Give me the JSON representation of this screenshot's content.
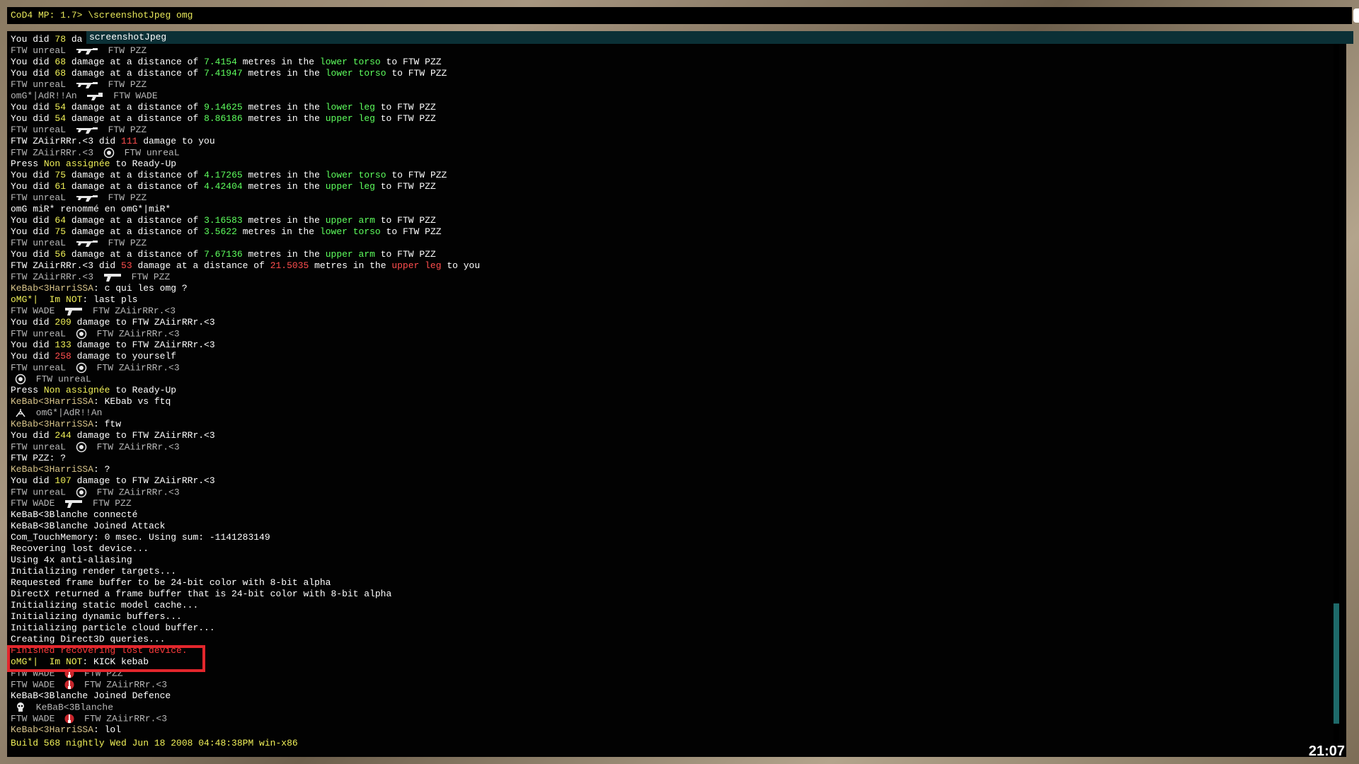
{
  "console": {
    "prompt": "CoD4 MP: 1.7>",
    "command": "\\screenshotJpeg omg",
    "autocomplete": "screenshotJpeg",
    "lines": [
      {
        "s": "normal",
        "p": [
          {
            "t": "You did "
          },
          {
            "t": "78",
            "c": "y"
          },
          {
            "t": " da"
          }
        ]
      },
      {
        "s": "dim",
        "p": [
          {
            "t": "FTW unreaL "
          },
          {
            "icon": "rifle-icon"
          },
          {
            "t": " FTW PZZ"
          }
        ]
      },
      {
        "s": "normal",
        "p": [
          {
            "t": "You did "
          },
          {
            "t": "68",
            "c": "y"
          },
          {
            "t": " damage at a distance of "
          },
          {
            "t": "7.4154",
            "c": "g"
          },
          {
            "t": " metres in the "
          },
          {
            "t": "lower torso",
            "c": "g"
          },
          {
            "t": " to FTW PZZ"
          }
        ]
      },
      {
        "s": "normal",
        "p": [
          {
            "t": "You did "
          },
          {
            "t": "68",
            "c": "y"
          },
          {
            "t": " damage at a distance of "
          },
          {
            "t": "7.41947",
            "c": "g"
          },
          {
            "t": " metres in the "
          },
          {
            "t": "lower torso",
            "c": "g"
          },
          {
            "t": " to FTW PZZ"
          }
        ]
      },
      {
        "s": "dim",
        "p": [
          {
            "t": "FTW unreaL "
          },
          {
            "icon": "rifle-icon"
          },
          {
            "t": " FTW PZZ"
          }
        ]
      },
      {
        "s": "dim",
        "p": [
          {
            "t": "omG*|AdR!!An "
          },
          {
            "icon": "grenade-launcher-icon"
          },
          {
            "t": " FTW WADE"
          }
        ]
      },
      {
        "s": "normal",
        "p": [
          {
            "t": "You did "
          },
          {
            "t": "54",
            "c": "y"
          },
          {
            "t": " damage at a distance of "
          },
          {
            "t": "9.14625",
            "c": "g"
          },
          {
            "t": " metres in the "
          },
          {
            "t": "lower leg",
            "c": "g"
          },
          {
            "t": " to FTW PZZ"
          }
        ]
      },
      {
        "s": "normal",
        "p": [
          {
            "t": "You did "
          },
          {
            "t": "54",
            "c": "y"
          },
          {
            "t": " damage at a distance of "
          },
          {
            "t": "8.86186",
            "c": "g"
          },
          {
            "t": " metres in the "
          },
          {
            "t": "upper leg",
            "c": "g"
          },
          {
            "t": " to FTW PZZ"
          }
        ]
      },
      {
        "s": "dim",
        "p": [
          {
            "t": "FTW unreaL "
          },
          {
            "icon": "rifle-icon"
          },
          {
            "t": " FTW PZZ"
          }
        ]
      },
      {
        "s": "normal",
        "p": [
          {
            "t": "FTW ZAiirRRr.<3 did "
          },
          {
            "t": "111",
            "c": "r"
          },
          {
            "t": " damage to you"
          }
        ]
      },
      {
        "s": "dim",
        "p": [
          {
            "t": "FTW ZAiirRRr.<3 "
          },
          {
            "icon": "grenade-icon"
          },
          {
            "t": " FTW unreaL"
          }
        ]
      },
      {
        "s": "normal",
        "p": [
          {
            "t": "Press "
          },
          {
            "t": "Non assignée",
            "c": "y"
          },
          {
            "t": " to Ready-Up"
          }
        ]
      },
      {
        "s": "normal",
        "p": [
          {
            "t": "You did "
          },
          {
            "t": "75",
            "c": "y"
          },
          {
            "t": " damage at a distance of "
          },
          {
            "t": "4.17265",
            "c": "g"
          },
          {
            "t": " metres in the "
          },
          {
            "t": "lower torso",
            "c": "g"
          },
          {
            "t": " to FTW PZZ"
          }
        ]
      },
      {
        "s": "normal",
        "p": [
          {
            "t": "You did "
          },
          {
            "t": "61",
            "c": "y"
          },
          {
            "t": " damage at a distance of "
          },
          {
            "t": "4.42404",
            "c": "g"
          },
          {
            "t": " metres in the "
          },
          {
            "t": "upper leg",
            "c": "g"
          },
          {
            "t": " to FTW PZZ"
          }
        ]
      },
      {
        "s": "dim",
        "p": [
          {
            "t": "FTW unreaL "
          },
          {
            "icon": "rifle-icon"
          },
          {
            "t": " FTW PZZ"
          }
        ]
      },
      {
        "s": "normal",
        "p": [
          {
            "t": "omG miR* renommé en omG*|miR*"
          }
        ]
      },
      {
        "s": "normal",
        "p": [
          {
            "t": "You did "
          },
          {
            "t": "64",
            "c": "y"
          },
          {
            "t": " damage at a distance of "
          },
          {
            "t": "3.16583",
            "c": "g"
          },
          {
            "t": " metres in the "
          },
          {
            "t": "upper arm",
            "c": "g"
          },
          {
            "t": " to FTW PZZ"
          }
        ]
      },
      {
        "s": "normal",
        "p": [
          {
            "t": "You did "
          },
          {
            "t": "75",
            "c": "y"
          },
          {
            "t": " damage at a distance of "
          },
          {
            "t": "3.5622",
            "c": "g"
          },
          {
            "t": " metres in the "
          },
          {
            "t": "lower torso",
            "c": "g"
          },
          {
            "t": " to FTW PZZ"
          }
        ]
      },
      {
        "s": "dim",
        "p": [
          {
            "t": "FTW unreaL "
          },
          {
            "icon": "rifle-icon"
          },
          {
            "t": " FTW PZZ"
          }
        ]
      },
      {
        "s": "normal",
        "p": [
          {
            "t": "You did "
          },
          {
            "t": "56",
            "c": "y"
          },
          {
            "t": " damage at a distance of "
          },
          {
            "t": "7.67136",
            "c": "g"
          },
          {
            "t": " metres in the "
          },
          {
            "t": "upper arm",
            "c": "g"
          },
          {
            "t": " to FTW PZZ"
          }
        ]
      },
      {
        "s": "normal",
        "p": [
          {
            "t": "FTW ZAiirRRr.<3 did "
          },
          {
            "t": "53",
            "c": "r"
          },
          {
            "t": " damage at a distance of "
          },
          {
            "t": "21.5035",
            "c": "r"
          },
          {
            "t": " metres in the "
          },
          {
            "t": "upper leg",
            "c": "r"
          },
          {
            "t": " to you"
          }
        ]
      },
      {
        "s": "dim",
        "p": [
          {
            "t": "FTW ZAiirRRr.<3 "
          },
          {
            "icon": "pistol-icon"
          },
          {
            "t": " FTW PZZ"
          }
        ]
      },
      {
        "s": "normal",
        "p": [
          {
            "t": "KeBab<3HarriSSA",
            "c": "c"
          },
          {
            "t": ": c qui les omg ?"
          }
        ]
      },
      {
        "s": "normal",
        "p": [
          {
            "t": "oMG*|  Im NOT",
            "c": "y"
          },
          {
            "t": ": last pls"
          }
        ]
      },
      {
        "s": "dim",
        "p": [
          {
            "t": "FTW WADE "
          },
          {
            "icon": "pistol-icon"
          },
          {
            "t": " FTW ZAiirRRr.<3"
          }
        ]
      },
      {
        "s": "normal",
        "p": [
          {
            "t": "You did "
          },
          {
            "t": "209",
            "c": "y"
          },
          {
            "t": " damage to FTW ZAiirRRr.<3"
          }
        ]
      },
      {
        "s": "dim",
        "p": [
          {
            "t": "FTW unreaL "
          },
          {
            "icon": "grenade-icon"
          },
          {
            "t": " FTW ZAiirRRr.<3"
          }
        ]
      },
      {
        "s": "normal",
        "p": [
          {
            "t": "You did "
          },
          {
            "t": "133",
            "c": "y"
          },
          {
            "t": " damage to FTW ZAiirRRr.<3"
          }
        ]
      },
      {
        "s": "normal",
        "p": [
          {
            "t": "You did "
          },
          {
            "t": "258",
            "c": "r"
          },
          {
            "t": " damage to yourself"
          }
        ]
      },
      {
        "s": "dim",
        "p": [
          {
            "t": "FTW unreaL "
          },
          {
            "icon": "grenade-icon"
          },
          {
            "t": " FTW ZAiirRRr.<3"
          }
        ]
      },
      {
        "s": "dim",
        "p": [
          {
            "icon": "grenade-icon"
          },
          {
            "t": " FTW unreaL"
          }
        ]
      },
      {
        "s": "normal",
        "p": [
          {
            "t": "Press "
          },
          {
            "t": "Non assignée",
            "c": "y"
          },
          {
            "t": " to Ready-Up"
          }
        ]
      },
      {
        "s": "normal",
        "p": [
          {
            "t": "KeBab<3HarriSSA",
            "c": "c"
          },
          {
            "t": ": KEbab vs ftq"
          }
        ]
      },
      {
        "s": "dim",
        "p": [
          {
            "icon": "fall-icon"
          },
          {
            "t": " omG*|AdR!!An"
          }
        ]
      },
      {
        "s": "normal",
        "p": [
          {
            "t": "KeBab<3HarriSSA",
            "c": "c"
          },
          {
            "t": ": ftw"
          }
        ]
      },
      {
        "s": "normal",
        "p": [
          {
            "t": "You did "
          },
          {
            "t": "244",
            "c": "y"
          },
          {
            "t": " damage to FTW ZAiirRRr.<3"
          }
        ]
      },
      {
        "s": "dim",
        "p": [
          {
            "t": "FTW unreaL "
          },
          {
            "icon": "grenade-icon"
          },
          {
            "t": " FTW ZAiirRRr.<3"
          }
        ]
      },
      {
        "s": "normal",
        "p": [
          {
            "t": "FTW PZZ: ?"
          }
        ]
      },
      {
        "s": "normal",
        "p": [
          {
            "t": "KeBab<3HarriSSA",
            "c": "c"
          },
          {
            "t": ": ?"
          }
        ]
      },
      {
        "s": "normal",
        "p": [
          {
            "t": "You did "
          },
          {
            "t": "107",
            "c": "y"
          },
          {
            "t": " damage to FTW ZAiirRRr.<3"
          }
        ]
      },
      {
        "s": "dim",
        "p": [
          {
            "t": "FTW unreaL "
          },
          {
            "icon": "grenade-icon"
          },
          {
            "t": " FTW ZAiirRRr.<3"
          }
        ]
      },
      {
        "s": "dim",
        "p": [
          {
            "t": "FTW WADE "
          },
          {
            "icon": "pistol-icon"
          },
          {
            "t": " FTW PZZ"
          }
        ]
      },
      {
        "s": "normal",
        "p": [
          {
            "t": "KeBaB<3Blanche connecté"
          }
        ]
      },
      {
        "s": "normal",
        "p": [
          {
            "t": "KeBaB<3Blanche Joined Attack"
          }
        ]
      },
      {
        "s": "normal",
        "p": [
          {
            "t": "Com_TouchMemory: 0 msec. Using sum: -1141283149"
          }
        ]
      },
      {
        "s": "normal",
        "p": [
          {
            "t": "Recovering lost device..."
          }
        ]
      },
      {
        "s": "normal",
        "p": [
          {
            "t": "Using 4x anti-aliasing"
          }
        ]
      },
      {
        "s": "normal",
        "p": [
          {
            "t": "Initializing render targets..."
          }
        ]
      },
      {
        "s": "normal",
        "p": [
          {
            "t": "Requested frame buffer to be 24-bit color with 8-bit alpha"
          }
        ]
      },
      {
        "s": "normal",
        "p": [
          {
            "t": "DirectX returned a frame buffer that is 24-bit color with 8-bit alpha"
          }
        ]
      },
      {
        "s": "normal",
        "p": [
          {
            "t": "Initializing static model cache..."
          }
        ]
      },
      {
        "s": "normal",
        "p": [
          {
            "t": "Initializing dynamic buffers..."
          }
        ]
      },
      {
        "s": "normal",
        "p": [
          {
            "t": "Initializing particle cloud buffer..."
          }
        ]
      },
      {
        "s": "normal",
        "p": [
          {
            "t": "Creating Direct3D queries..."
          }
        ]
      },
      {
        "s": "red",
        "p": [
          {
            "t": "Finished recovering lost device."
          }
        ]
      },
      {
        "s": "normal",
        "p": [
          {
            "t": "oMG*|  Im NOT",
            "c": "y"
          },
          {
            "t": ": KICK kebab"
          }
        ]
      },
      {
        "s": "dim",
        "p": [
          {
            "t": "FTW WADE "
          },
          {
            "icon": "knife-icon"
          },
          {
            "t": " FTW PZZ"
          }
        ]
      },
      {
        "s": "dim",
        "p": [
          {
            "t": "FTW WADE "
          },
          {
            "icon": "knife-icon"
          },
          {
            "t": " FTW ZAiirRRr.<3"
          }
        ]
      },
      {
        "s": "normal",
        "p": [
          {
            "t": "KeBaB<3Blanche Joined Defence"
          }
        ]
      },
      {
        "s": "dim",
        "p": [
          {
            "icon": "skull-icon"
          },
          {
            "t": " KeBaB<3Blanche"
          }
        ]
      },
      {
        "s": "dim",
        "p": [
          {
            "t": "FTW WADE "
          },
          {
            "icon": "knife-icon"
          },
          {
            "t": " FTW ZAiirRRr.<3"
          }
        ]
      },
      {
        "s": "normal",
        "p": [
          {
            "t": "KeBab<3HarriSSA",
            "c": "c"
          },
          {
            "t": ": lol"
          }
        ]
      }
    ],
    "build": "Build 568 nightly Wed Jun 18 2008 04:48:38PM win-x86",
    "scroll_position": 0.85
  },
  "hud": {
    "clock": "21:07"
  },
  "colors": {
    "highlight": "#e3262c",
    "accent_yellow": "#f0f058",
    "green": "#5eff5e",
    "red": "#ff4e4e"
  }
}
